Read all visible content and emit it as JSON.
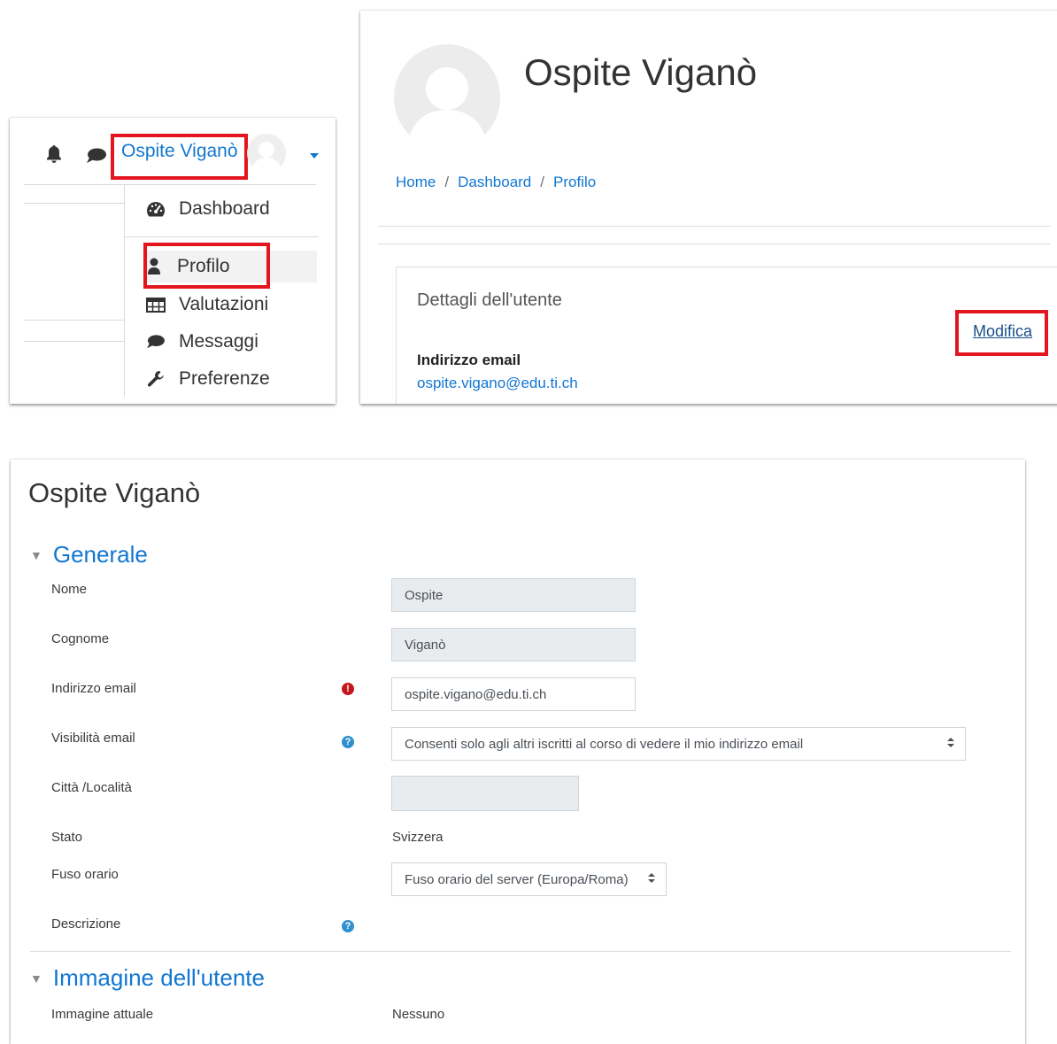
{
  "colors": {
    "accent": "#1177d1",
    "highlight": "#e3161f",
    "required": "#c5161d",
    "help": "#2f8fd0"
  },
  "user_menu": {
    "username": "Ospite Viganò",
    "icons": {
      "notifications": "bell-icon",
      "messages": "chat-bubble-icon",
      "dropdown": "caret-down-icon",
      "avatar": "avatar-icon"
    },
    "items": [
      {
        "label": "Dashboard",
        "icon": "tachometer-icon"
      },
      {
        "label": "Profilo",
        "icon": "user-icon"
      },
      {
        "label": "Valutazioni",
        "icon": "table-icon"
      },
      {
        "label": "Messaggi",
        "icon": "chat-bubble-icon"
      },
      {
        "label": "Preferenze",
        "icon": "wrench-icon"
      }
    ]
  },
  "profile": {
    "name": "Ospite Viganò",
    "breadcrumb": [
      "Home",
      "Dashboard",
      "Profilo"
    ],
    "breadcrumb_sep": "/",
    "details_title": "Dettagli dell'utente",
    "edit_link": "Modifica",
    "email_label": "Indirizzo email",
    "email_value": "ospite.vigano@edu.ti.ch"
  },
  "edit_form": {
    "title": "Ospite Viganò",
    "sections": {
      "general": "Generale",
      "image": "Immagine dell'utente"
    },
    "fields": {
      "nome": {
        "label": "Nome",
        "value": "Ospite"
      },
      "cognome": {
        "label": "Cognome",
        "value": "Viganò"
      },
      "email": {
        "label": "Indirizzo email",
        "value": "ospite.vigano@edu.ti.ch"
      },
      "email_visibility": {
        "label": "Visibilità email",
        "value": "Consenti solo agli altri iscritti al corso di vedere il mio indirizzo email"
      },
      "city": {
        "label": "Città /Località",
        "value": ""
      },
      "country": {
        "label": "Stato",
        "value": "Svizzera"
      },
      "timezone": {
        "label": "Fuso orario",
        "value": "Fuso orario del server (Europa/Roma)"
      },
      "description": {
        "label": "Descrizione"
      },
      "current_image": {
        "label": "Immagine attuale",
        "value": "Nessuno"
      }
    },
    "icons": {
      "required": "exclamation-icon",
      "help": "question-icon",
      "collapse": "triangle-down-icon",
      "select": "sort-arrows-icon"
    },
    "required_glyph": "!",
    "help_glyph": "?"
  }
}
